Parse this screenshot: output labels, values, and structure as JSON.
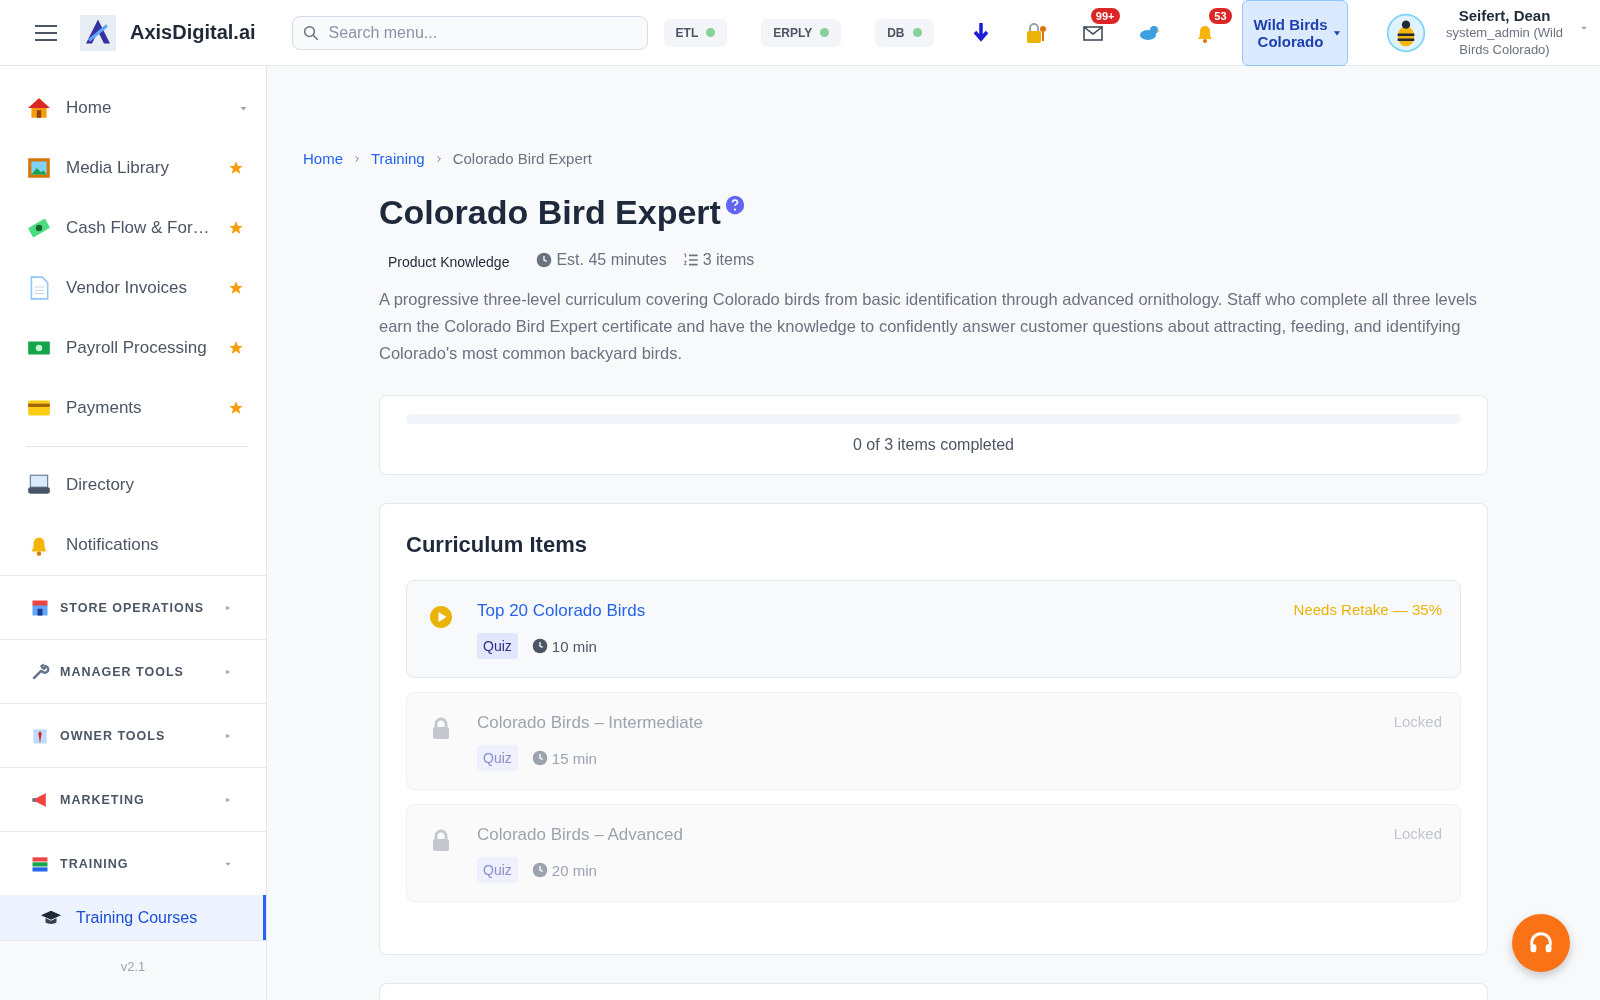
{
  "header": {
    "brand": "AxisDigital.ai",
    "search": {
      "placeholder": "Search menu..."
    },
    "services": [
      {
        "label": "ETL",
        "color": "#86d19a"
      },
      {
        "label": "ERPLY",
        "color": "#86d19a"
      },
      {
        "label": "DB",
        "color": "#86d19a"
      }
    ],
    "mail_badge": "99+",
    "bell_badge": "53",
    "store": "Wild Birds Colorado",
    "user": {
      "name": "Seifert, Dean",
      "role": "system_admin (Wild Birds Colorado)"
    }
  },
  "sidebar": {
    "items": [
      {
        "label": "Home",
        "kind": "dropdown"
      },
      {
        "label": "Media Library",
        "kind": "favorite"
      },
      {
        "label": "Cash Flow & For…",
        "kind": "favorite"
      },
      {
        "label": "Vendor Invoices",
        "kind": "favorite"
      },
      {
        "label": "Payroll Processing",
        "kind": "favorite"
      },
      {
        "label": "Payments",
        "kind": "favorite"
      },
      {
        "label": "Directory",
        "kind": "plain"
      },
      {
        "label": "Notifications",
        "kind": "plain"
      }
    ],
    "sections": [
      {
        "label": "STORE OPERATIONS",
        "expanded": false
      },
      {
        "label": "MANAGER TOOLS",
        "expanded": false
      },
      {
        "label": "OWNER TOOLS",
        "expanded": false
      },
      {
        "label": "MARKETING",
        "expanded": false
      },
      {
        "label": "TRAINING",
        "expanded": true,
        "children": [
          {
            "label": "Training Courses",
            "selected": true
          }
        ]
      }
    ],
    "version": "v2.1"
  },
  "main": {
    "breadcrumb": [
      {
        "label": "Home",
        "link": true
      },
      {
        "label": "Training",
        "link": true
      },
      {
        "label": "Colorado Bird Expert",
        "link": false
      }
    ],
    "title": "Colorado Bird Expert",
    "category": "Product Knowledge",
    "duration": "Est. 45 minutes",
    "count": "3 items",
    "description": "A progressive three-level curriculum covering Colorado birds from basic identification through advanced ornithology. Staff who complete all three levels earn the Colorado Bird Expert certificate and have the knowledge to confidently answer customer questions about attracting, feeding, and identifying Colorado's most common backyard birds.",
    "progress": {
      "level": 0,
      "text": "0 of 3 items completed"
    },
    "curriculum": {
      "heading": "Curriculum Items",
      "items": [
        {
          "title": "Top 20 Colorado Birds",
          "type": "Quiz",
          "duration": "10 min",
          "status": "Needs Retake — 35%",
          "kind": "available"
        },
        {
          "title": "Colorado Birds – Intermediate",
          "type": "Quiz",
          "duration": "15 min",
          "status": "Locked",
          "kind": "locked"
        },
        {
          "title": "Colorado Birds – Advanced",
          "type": "Quiz",
          "duration": "20 min",
          "status": "Locked",
          "kind": "locked"
        }
      ]
    }
  }
}
